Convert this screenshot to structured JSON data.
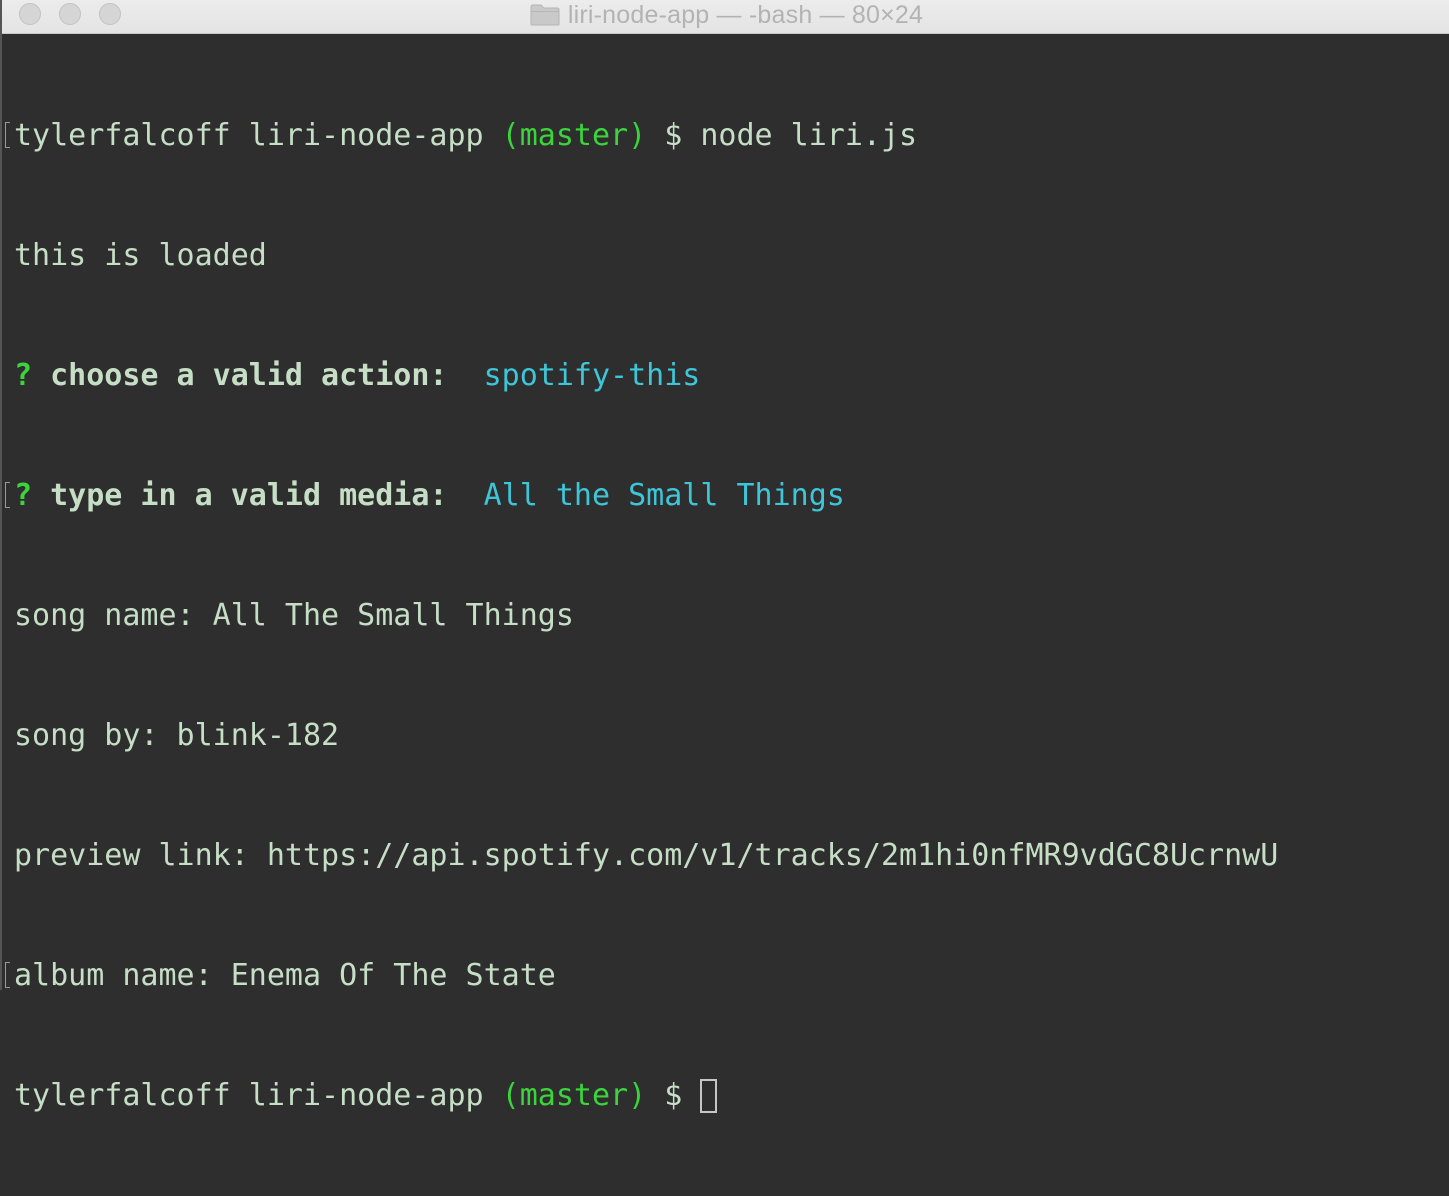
{
  "window": {
    "title": "liri-node-app — -bash — 80×24"
  },
  "icons": {
    "title_icon": "folder-icon"
  },
  "colors": {
    "background": "#2e2e2e",
    "text": "#c6dec6",
    "prompt_branch": "#3bd43b",
    "answer": "#3ec6d8"
  },
  "terminal": {
    "line1": {
      "user_dir": "tylerfalcoff liri-node-app ",
      "branch": "(master)",
      "cmd": " $ node liri.js"
    },
    "line2": "this is loaded",
    "line3": {
      "q": "?",
      "question": " choose a valid action:",
      "answer": "  spotify-this"
    },
    "line4": {
      "q": "?",
      "question": " type in a valid media:",
      "answer": "  All the Small Things"
    },
    "line5": "song name: All The Small Things",
    "line6": "song by: blink-182",
    "line7": "preview link: https://api.spotify.com/v1/tracks/2m1hi0nfMR9vdGC8UcrnwU",
    "line8": "album name: Enema Of The State",
    "line9": {
      "user_dir": "tylerfalcoff liri-node-app ",
      "branch": "(master)",
      "cmd": " $ "
    }
  }
}
